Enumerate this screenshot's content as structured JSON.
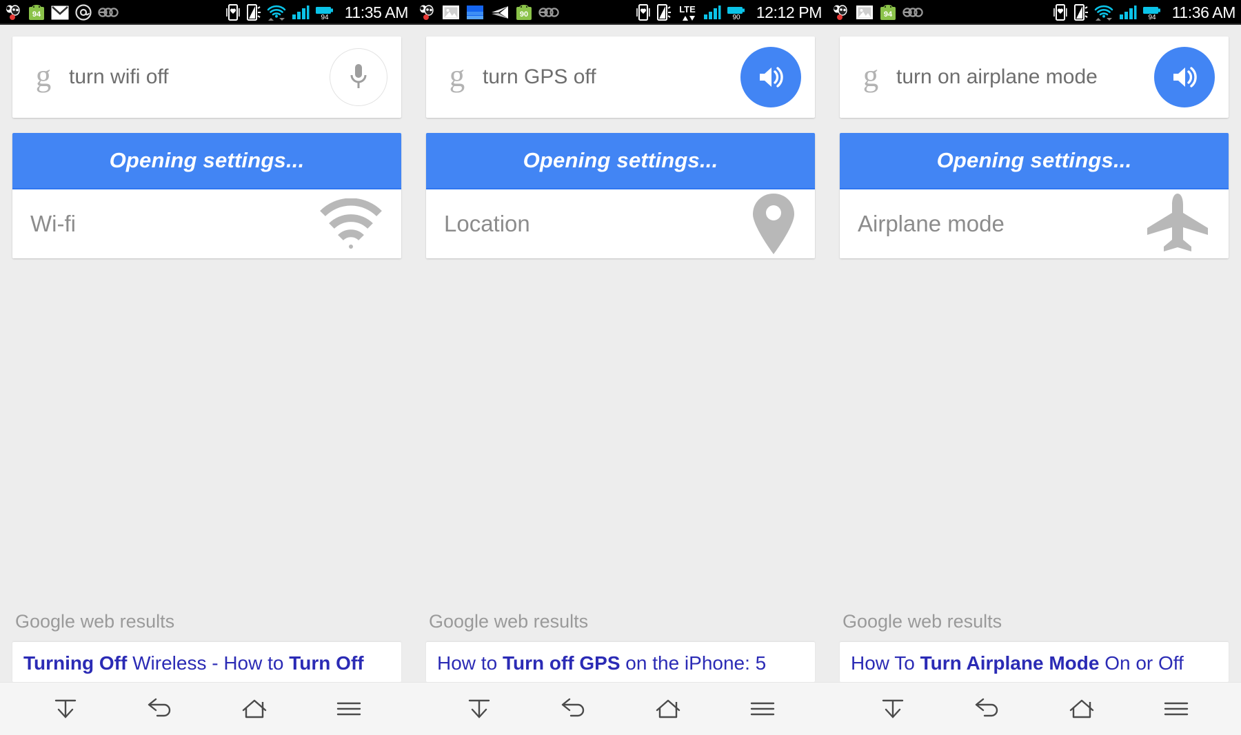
{
  "meta": {
    "accent_blue": "#4285f4",
    "link_blue": "#2b2bb5",
    "background": "#ededed",
    "statusbar_bg": "#000000",
    "label_gray": "#8c8c8c"
  },
  "panels": [
    {
      "status": {
        "time": "11:35 AM",
        "left_icons": [
          "panda-notification-icon",
          "android-update-94-icon",
          "gmail-icon",
          "at-mention-icon",
          "eco-icon"
        ],
        "right_icons": [
          "vibrate-heart-icon",
          "silent-phone-icon",
          "wifi-icon",
          "cell-signal-icon",
          "battery-94-icon"
        ]
      },
      "search": {
        "logo": "google-g-logo",
        "query": "turn wifi off",
        "action_icon": "microphone-icon",
        "action_type": "mic"
      },
      "result": {
        "status_text": "Opening settings...",
        "setting_label": "Wi-fi",
        "setting_icon": "wifi-icon"
      },
      "web": {
        "header": "Google web results",
        "result_title_parts": [
          {
            "text": "Turning Off ",
            "bold": true
          },
          {
            "text": "Wireless - How to ",
            "bold": false
          },
          {
            "text": "Turn Off",
            "bold": true
          }
        ]
      },
      "nav": {
        "buttons": [
          "hide-keyboard-icon",
          "back-icon",
          "home-icon",
          "recent-apps-icon"
        ]
      }
    },
    {
      "status": {
        "time": "12:12 PM",
        "left_icons": [
          "panda-notification-icon",
          "photo-icon",
          "gallery-blue-icon",
          "paper-plane-icon",
          "android-update-90-icon",
          "eco-icon"
        ],
        "right_icons": [
          "vibrate-heart-icon",
          "silent-phone-icon",
          "lte-icon",
          "cell-signal-icon",
          "battery-90-icon"
        ]
      },
      "search": {
        "logo": "google-g-logo",
        "query": "turn GPS off",
        "action_icon": "speaker-icon",
        "action_type": "speaker"
      },
      "result": {
        "status_text": "Opening settings...",
        "setting_label": "Location",
        "setting_icon": "location-pin-icon"
      },
      "web": {
        "header": "Google web results",
        "result_title_parts": [
          {
            "text": "How to ",
            "bold": false
          },
          {
            "text": "Turn off GPS",
            "bold": true
          },
          {
            "text": " on the iPhone: 5",
            "bold": false
          }
        ]
      },
      "nav": {
        "buttons": [
          "hide-keyboard-icon",
          "back-icon",
          "home-icon",
          "recent-apps-icon"
        ]
      }
    },
    {
      "status": {
        "time": "11:36 AM",
        "left_icons": [
          "panda-notification-icon",
          "photo-icon",
          "android-update-94-icon",
          "eco-icon"
        ],
        "right_icons": [
          "vibrate-heart-icon",
          "silent-phone-icon",
          "wifi-icon",
          "cell-signal-icon",
          "battery-94-icon"
        ]
      },
      "search": {
        "logo": "google-g-logo",
        "query": "turn on airplane mode",
        "action_icon": "speaker-icon",
        "action_type": "speaker"
      },
      "result": {
        "status_text": "Opening settings...",
        "setting_label": "Airplane mode",
        "setting_icon": "airplane-icon"
      },
      "web": {
        "header": "Google web results",
        "result_title_parts": [
          {
            "text": "How To ",
            "bold": false
          },
          {
            "text": "Turn Airplane Mode",
            "bold": true
          },
          {
            "text": " On or Off",
            "bold": false
          }
        ]
      },
      "nav": {
        "buttons": [
          "hide-keyboard-icon",
          "back-icon",
          "home-icon",
          "recent-apps-icon"
        ]
      }
    }
  ]
}
